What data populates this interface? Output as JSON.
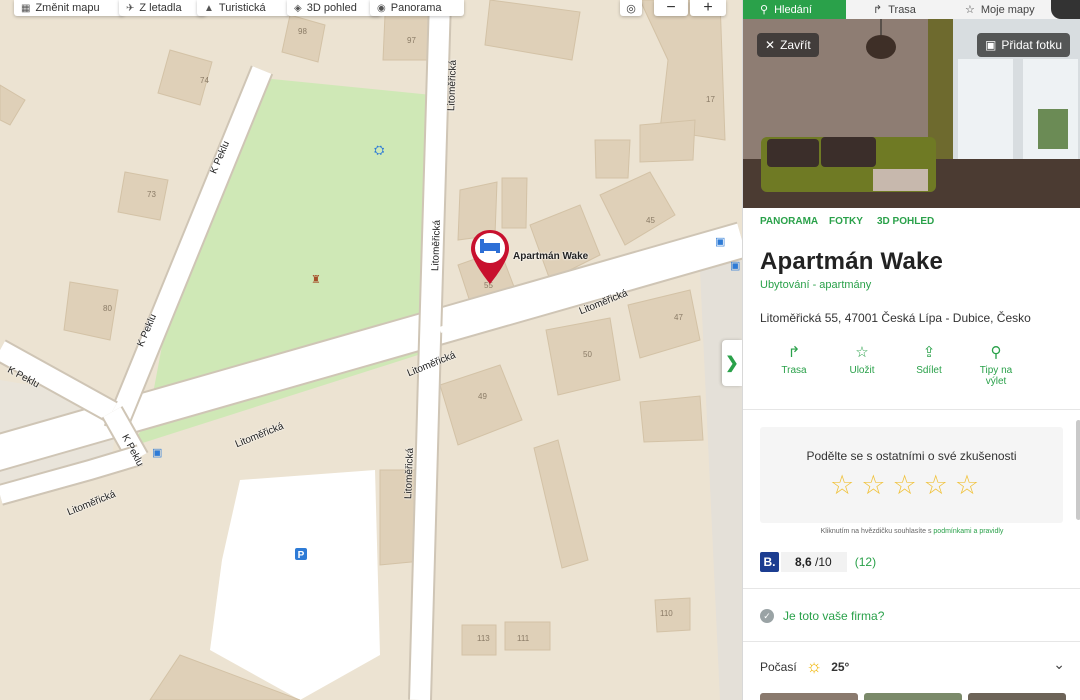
{
  "map": {
    "toolbar": {
      "change_map": "Změnit mapu",
      "from_plane": "Z letadla",
      "tourist": "Turistická",
      "view3d": "3D pohled",
      "panorama": "Panorama"
    },
    "zoom_out": "−",
    "zoom_in": "+",
    "streets": {
      "k_peklu_1": "K Peklu",
      "k_peklu_2": "K Peklu",
      "k_peklu_3": "K Peklu",
      "k_peklu_4": "K Peklu",
      "litomericka_v1": "Litoměřická",
      "litomericka_v2": "Litoměřická",
      "litomericka_v3": "Litoměřická",
      "litomericka_d1": "Litoměřická",
      "litomericka_d2": "Litoměřická",
      "litomericka_d3": "Litoměřická",
      "litomericka_d4": "Litoměřická"
    },
    "house_numbers": [
      "98",
      "97",
      "74",
      "17",
      "73",
      "45",
      "80",
      "47",
      "50",
      "49",
      "110",
      "113",
      "111",
      "55"
    ],
    "poi_label": "Apartmán Wake",
    "parking_label": "P"
  },
  "panel": {
    "tabs": {
      "search": "Hledání",
      "route": "Trasa",
      "my_maps": "Moje mapy"
    },
    "close_label": "Zavřít",
    "add_photo_label": "Přidat fotku",
    "photo_links": [
      "PANORAMA",
      "FOTKY",
      "3D POHLED"
    ],
    "title": "Apartmán Wake",
    "category": "Ubytování - apartmány",
    "address": "Litoměřická 55, 47001 Česká Lípa - Dubice, Česko",
    "actions": {
      "route": "Trasa",
      "save": "Uložit",
      "share": "Sdílet",
      "trip1": "Tipy na",
      "trip2": "výlet"
    },
    "rate_prompt": "Podělte se s ostatními o své zkušenosti",
    "terms_prefix": "Kliknutím na hvězdičku souhlasíte s",
    "terms_link": "podmínkami a pravidly",
    "booking": {
      "logo": "B.",
      "score": "8,6",
      "scale": "/10",
      "count": "(12)"
    },
    "firm_question": "Je toto vaše firma?",
    "weather": {
      "label": "Počasí",
      "temp": "25°"
    }
  },
  "colors": {
    "accent": "#2aa14a",
    "park": "#cfe8b6",
    "road": "#ffffff",
    "building": "#dfd0b8",
    "booking": "#1c3d91",
    "pin": "#c8102e"
  }
}
